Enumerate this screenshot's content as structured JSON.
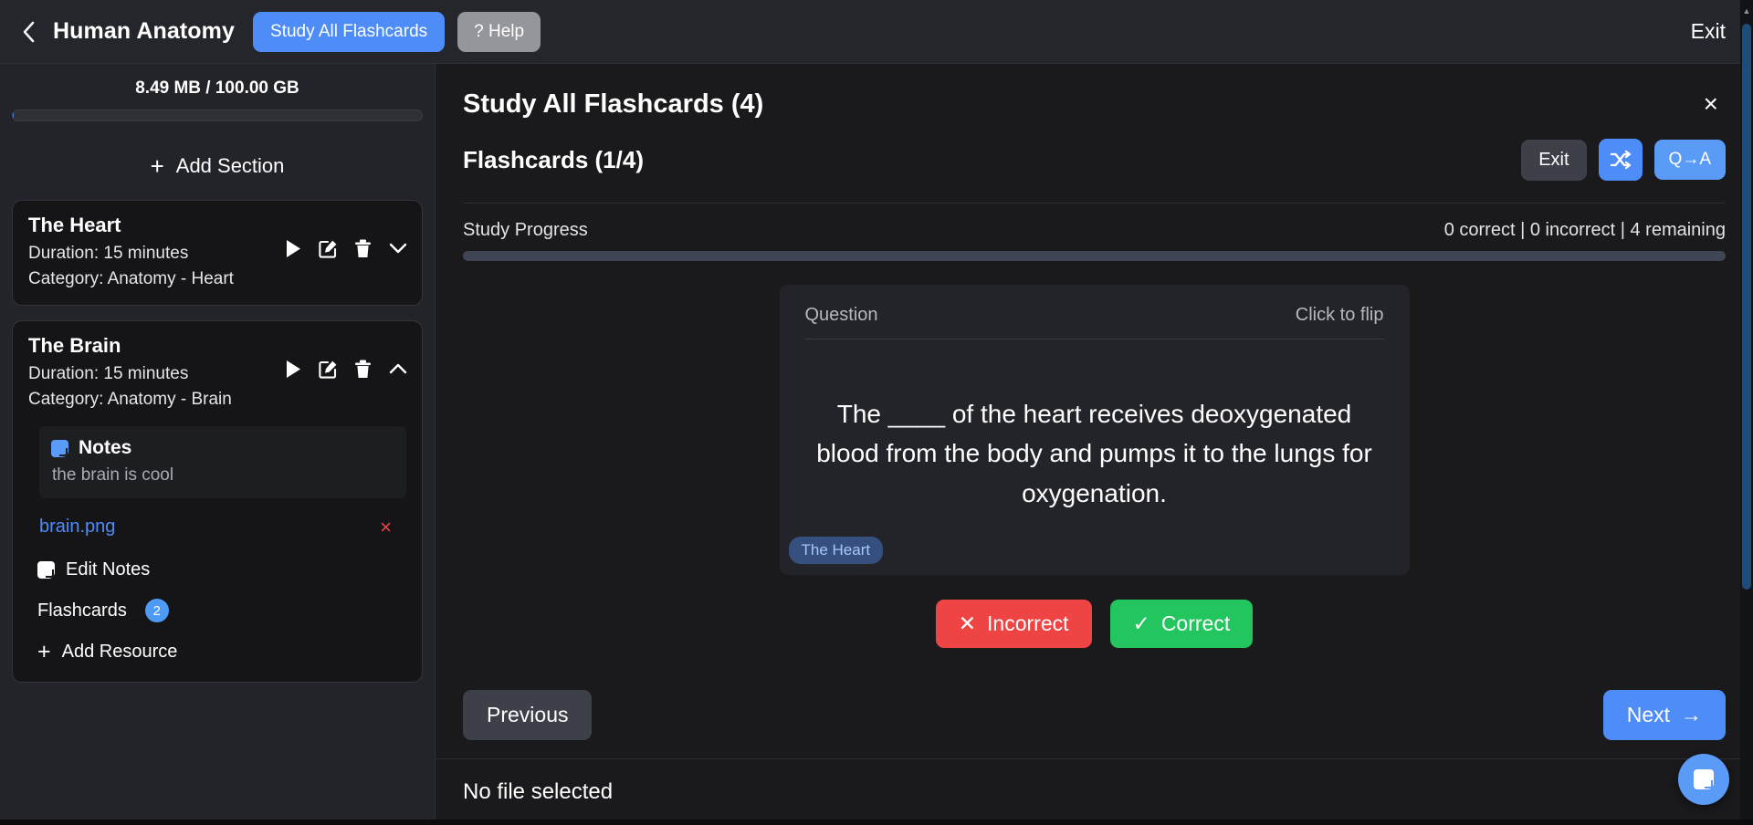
{
  "topbar": {
    "back_icon": "chevron-left-icon",
    "course_title": "Human Anatomy",
    "study_all_label": "Study All Flashcards",
    "help_label": "? Help",
    "exit_label": "Exit"
  },
  "sidebar": {
    "storage_text": "8.49 MB / 100.00 GB",
    "add_section_plus": "+",
    "add_section_label": "Add Section",
    "sections": [
      {
        "name": "The Heart",
        "duration": "Duration: 15 minutes",
        "category": "Category: Anatomy - Heart",
        "expanded": false,
        "chevron": "chevron-down-icon"
      },
      {
        "name": "The Brain",
        "duration": "Duration: 15 minutes",
        "category": "Category: Anatomy - Brain",
        "expanded": true,
        "chevron": "chevron-up-icon",
        "notes_title": "Notes",
        "notes_body": "the brain is cool",
        "file_name": "brain.png",
        "file_remove": "×",
        "edit_notes_label": "Edit Notes",
        "flashcards_label": "Flashcards",
        "flashcards_count": "2",
        "add_resource_plus": "+",
        "add_resource_label": "Add Resource"
      }
    ]
  },
  "main": {
    "study_title": "Study All Flashcards (4)",
    "close_icon": "×",
    "flashcard_counter": "Flashcards (1/4)",
    "tool_exit_label": "Exit",
    "tool_shuffle_icon": "shuffle-icon",
    "tool_qa_label": "Q→A",
    "progress_label": "Study Progress",
    "progress_stats": "0 correct | 0 incorrect | 4 remaining",
    "progress_percent": 0,
    "card": {
      "side_label": "Question",
      "flip_hint": "Click to flip",
      "text": "The ____ of the heart receives deoxygenated blood from the body and pumps it to the lungs for oxygenation.",
      "tag": "The Heart"
    },
    "incorrect_label": "Incorrect",
    "incorrect_icon": "✕",
    "correct_label": "Correct",
    "correct_icon": "✓",
    "previous_label": "Previous",
    "next_label": "Next",
    "next_arrow": "→",
    "footer_status": "No file selected"
  },
  "colors": {
    "accent_blue": "#4e8cf7",
    "danger_red": "#ef4444",
    "success_green": "#22c55e",
    "link_blue": "#4e8cf7"
  }
}
